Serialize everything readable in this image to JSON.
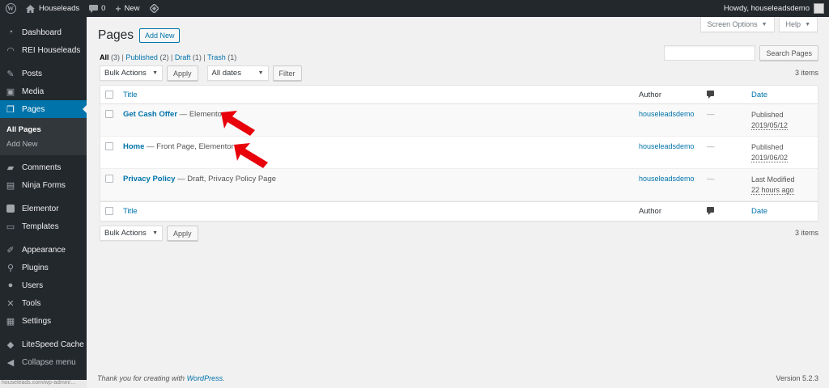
{
  "adminbar": {
    "site_name": "Houseleads",
    "comments_count": "0",
    "new_label": "New",
    "greeting": "Howdy, houseleadsdemo"
  },
  "sidebar": {
    "items": [
      {
        "label": "Dashboard",
        "icon": "dashboard-icon"
      },
      {
        "label": "REI Houseleads",
        "icon": "rei-icon"
      },
      {
        "label": "Posts",
        "icon": "pin-icon"
      },
      {
        "label": "Media",
        "icon": "media-icon"
      },
      {
        "label": "Pages",
        "icon": "pages-icon"
      },
      {
        "label": "Comments",
        "icon": "comments-icon"
      },
      {
        "label": "Ninja Forms",
        "icon": "ninja-forms-icon"
      },
      {
        "label": "Elementor",
        "icon": "elementor-icon"
      },
      {
        "label": "Templates",
        "icon": "templates-icon"
      },
      {
        "label": "Appearance",
        "icon": "brush-icon"
      },
      {
        "label": "Plugins",
        "icon": "plugin-icon"
      },
      {
        "label": "Users",
        "icon": "users-icon"
      },
      {
        "label": "Tools",
        "icon": "tools-icon"
      },
      {
        "label": "Settings",
        "icon": "settings-icon"
      },
      {
        "label": "LiteSpeed Cache",
        "icon": "litespeed-icon"
      },
      {
        "label": "Collapse menu",
        "icon": "collapse-icon"
      }
    ],
    "submenu": [
      "All Pages",
      "Add New"
    ],
    "status_text": "houseleads.com/wp-admin/..."
  },
  "screen_options": "Screen Options",
  "help": "Help",
  "page": {
    "title": "Pages",
    "add_new": "Add New"
  },
  "views": {
    "all": "All",
    "all_count": "(3)",
    "published": "Published",
    "published_count": "(2)",
    "draft": "Draft",
    "draft_count": "(1)",
    "trash": "Trash",
    "trash_count": "(1)",
    "sep": "|"
  },
  "search": {
    "button": "Search Pages"
  },
  "bulk": {
    "label": "Bulk Actions",
    "apply": "Apply",
    "dates": "All dates",
    "filter": "Filter"
  },
  "items_count": "3 items",
  "table": {
    "headers": {
      "title": "Title",
      "author": "Author",
      "date": "Date"
    },
    "rows": [
      {
        "title": "Get Cash Offer",
        "state": " — Elementor",
        "author": "houseleadsdemo",
        "comments": "—",
        "date_status": "Published",
        "date_value": "2019/05/12"
      },
      {
        "title": "Home",
        "state": " — Front Page, Elementor",
        "author": "houseleadsdemo",
        "comments": "—",
        "date_status": "Published",
        "date_value": "2019/06/02"
      },
      {
        "title": "Privacy Policy",
        "state": " — Draft, Privacy Policy Page",
        "author": "houseleadsdemo",
        "comments": "—",
        "date_status": "Last Modified",
        "date_value": "22 hours ago"
      }
    ]
  },
  "footer": {
    "thanks_prefix": "Thank you for creating with ",
    "wordpress": "WordPress",
    "thanks_suffix": ".",
    "version": "Version 5.2.3"
  },
  "colors": {
    "accent": "#0073aa",
    "sidebar_bg": "#23282d",
    "arrow": "#e8000b"
  }
}
